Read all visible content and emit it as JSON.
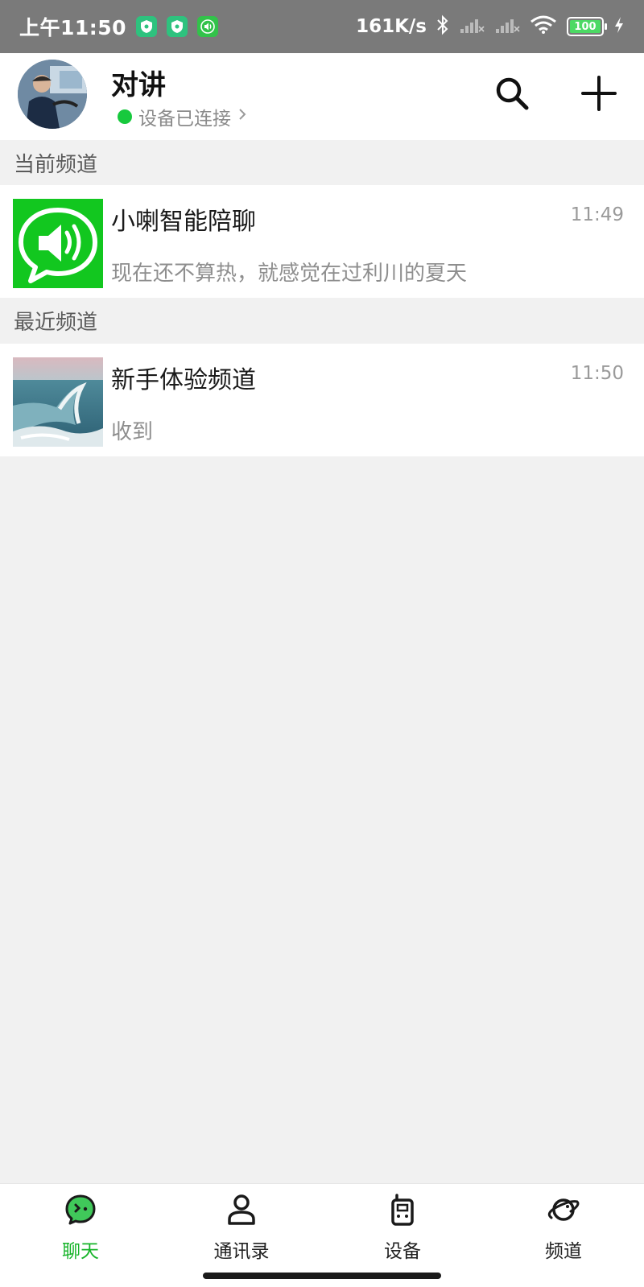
{
  "status_bar": {
    "time": "上午11:50",
    "speed": "161K/s",
    "battery": "100",
    "icons": [
      "shield-app-icon",
      "shield-app-icon",
      "speaker-app-icon",
      "bluetooth-icon",
      "signal-icon",
      "signal-icon",
      "wifi-icon",
      "battery-icon",
      "charging-icon"
    ]
  },
  "header": {
    "title": "对讲",
    "connection_status": "设备已连接",
    "connection_color": "#17c93d",
    "search_icon": "search-icon",
    "add_icon": "plus-icon"
  },
  "sections": {
    "current_title": "当前频道",
    "recent_title": "最近频道"
  },
  "current_channel": {
    "name": "小喇智能陪聊",
    "time": "11:49",
    "last_message": "现在还不算热，就感觉在过利川的夏天",
    "thumb_icon": "speaker-bubble-icon",
    "thumb_color": "#12c71f"
  },
  "recent_channels": [
    {
      "name": "新手体验频道",
      "time": "11:50",
      "last_message": "收到",
      "thumb": "ocean-wave-image"
    }
  ],
  "bottom_nav": [
    {
      "label": "聊天",
      "icon": "chat-bubble-icon",
      "active": true
    },
    {
      "label": "通讯录",
      "icon": "person-icon",
      "active": false
    },
    {
      "label": "设备",
      "icon": "walkie-talkie-icon",
      "active": false
    },
    {
      "label": "频道",
      "icon": "planet-icon",
      "active": false
    }
  ],
  "colors": {
    "accent": "#17b42a",
    "background": "#f1f1f1",
    "status_bar": "#7a7a7a"
  }
}
